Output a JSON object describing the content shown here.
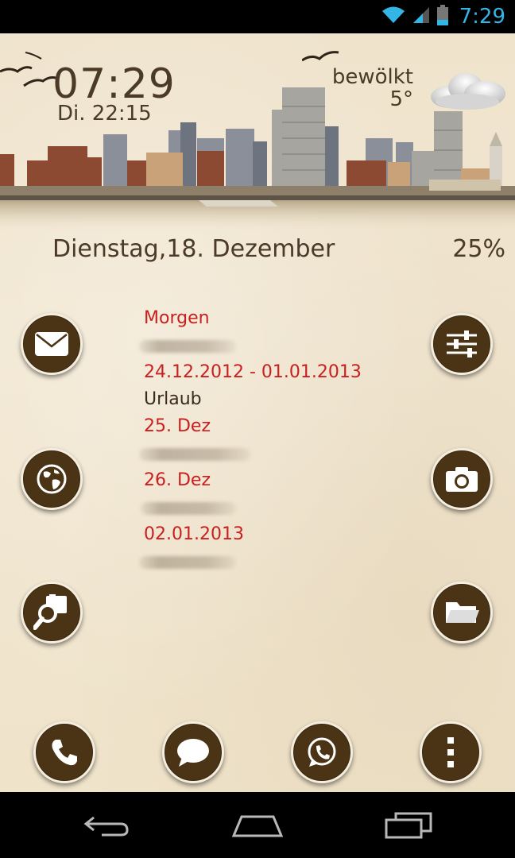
{
  "status_bar": {
    "time": "7:29",
    "icons": [
      "wifi-icon",
      "signal-icon",
      "battery-icon"
    ],
    "accent_color": "#33b5e5"
  },
  "clock_widget": {
    "time": "07:29",
    "alarm": "Di. 22:15"
  },
  "weather_widget": {
    "condition": "bewölkt",
    "temperature": "5°",
    "icon": "cloud-icon"
  },
  "date_widget": {
    "date": "Dienstag,18. Dezember",
    "battery": "25%"
  },
  "calendar": {
    "entries": [
      {
        "date": "Morgen",
        "title": ""
      },
      {
        "date": "24.12.2012 - 01.01.2013",
        "title": "Urlaub"
      },
      {
        "date": "25. Dez",
        "title": ""
      },
      {
        "date": "26. Dez",
        "title": ""
      },
      {
        "date": "02.01.2013",
        "title": ""
      }
    ],
    "date_color": "#c8201f",
    "title_color": "#3a2c1c"
  },
  "left_icons": [
    "mail-icon",
    "globe-icon",
    "photo-search-icon"
  ],
  "right_icons": [
    "settings-sliders-icon",
    "camera-icon",
    "folder-icon"
  ],
  "dock": [
    "phone-icon",
    "chat-bubble-icon",
    "whatsapp-icon",
    "menu-dots-icon"
  ],
  "nav_bar": [
    "back-icon",
    "home-icon",
    "recents-icon"
  ],
  "theme": {
    "icon_bg": "#4b3415",
    "text_color": "#4a3a26"
  }
}
